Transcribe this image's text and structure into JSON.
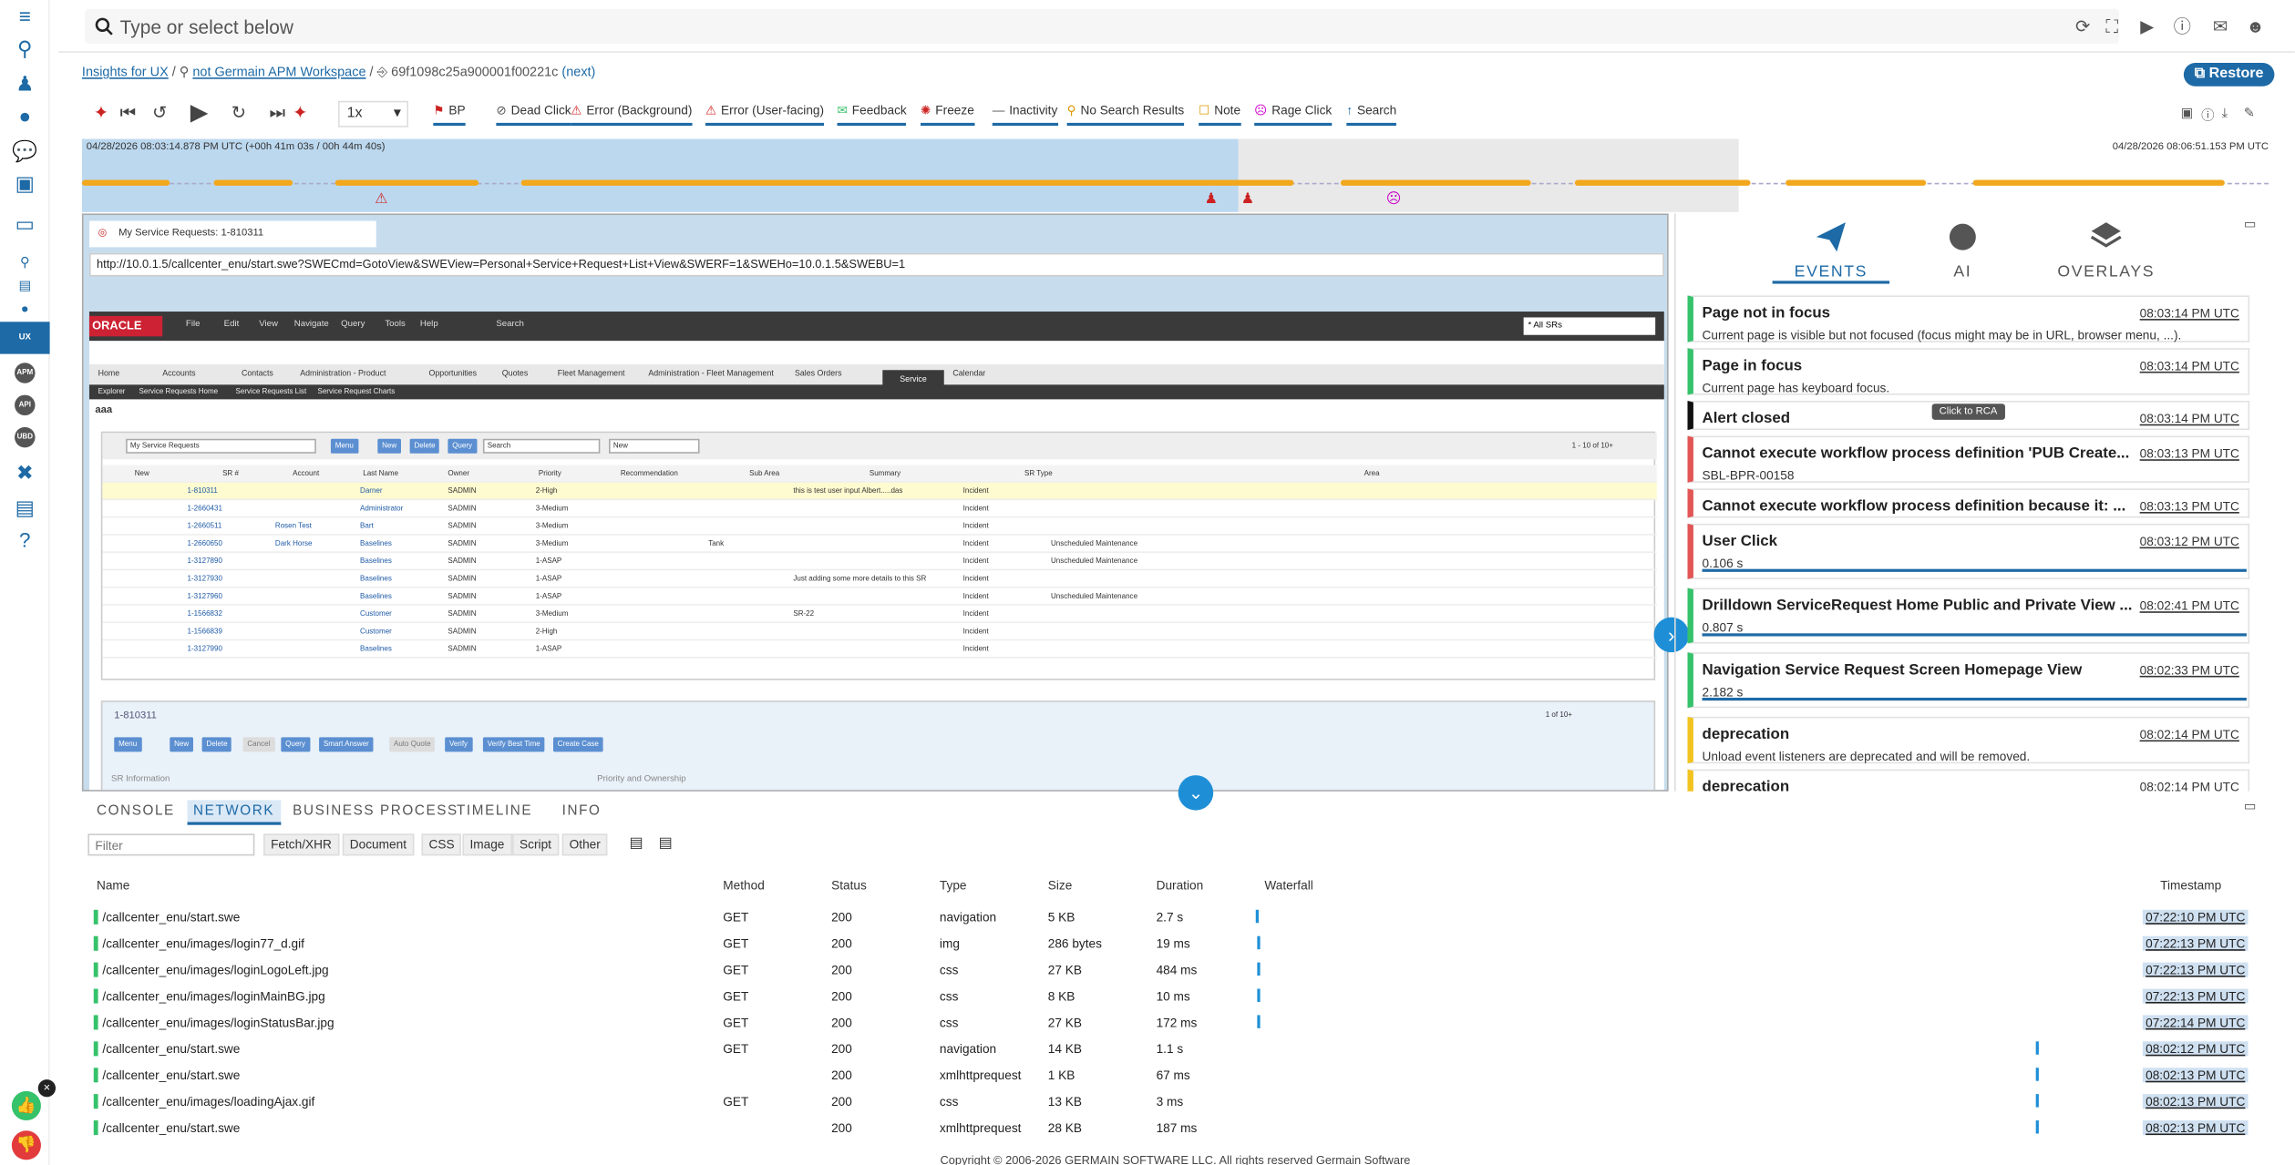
{
  "search": {
    "placeholder": "Type or select below"
  },
  "breadcrumb": {
    "home": "Insights for UX",
    "workspace": "not Germain APM Workspace",
    "session": "69f1098c25a900001f00221c",
    "next": "(next)"
  },
  "restore_label": "Restore",
  "controls": {
    "speed": "1x"
  },
  "event_filters": [
    "BP",
    "Dead Click",
    "Error (Background)",
    "Error (User-facing)",
    "Feedback",
    "Freeze",
    "Inactivity",
    "No Search Results",
    "Note",
    "Rage Click",
    "Search"
  ],
  "timeline": {
    "start": "04/28/2026 08:03:14.878 PM UTC (+00h 41m 03s / 00h 44m 40s)",
    "end": "04/28/2026 08:06:51.153 PM UTC"
  },
  "replay": {
    "tab_title": "My Service Requests: 1-810311",
    "url": "http://10.0.1.5/callcenter_enu/start.swe?SWECmd=GotoView&SWEView=Personal+Service+Request+List+View&SWERF=1&SWEHo=10.0.1.5&SWEBU=1",
    "menu": [
      "File",
      "Edit",
      "View",
      "Navigate",
      "Query",
      "Tools",
      "Help",
      "Search"
    ],
    "all_srs": "* All SRs",
    "tabs": [
      "Home",
      "Accounts",
      "Contacts",
      "Administration - Product",
      "Opportunities",
      "Quotes",
      "Fleet Management",
      "Administration - Fleet Management",
      "Sales Orders",
      "Service",
      "Calendar"
    ],
    "subtabs": [
      "Explorer",
      "Service Requests Home",
      "Service Requests List",
      "Service Request Charts"
    ],
    "aaa": "aaa",
    "list_view": "My Service Requests",
    "list_buttons": [
      "Menu",
      "New",
      "Delete",
      "Query"
    ],
    "list_search": "Search",
    "list_new": "New",
    "list_count": "1 - 10 of 10+",
    "columns": [
      "New",
      "SR #",
      "Account",
      "Last Name",
      "Owner",
      "Priority",
      "Recommendation",
      "Sub Area",
      "Summary",
      "SR Type",
      "Area"
    ],
    "rows": [
      [
        "1-810311",
        "",
        "Darner",
        "SADMIN",
        "2-High",
        "",
        "this is test user input Albert.....das",
        "Incident",
        ""
      ],
      [
        "1-2660431",
        "",
        "Administrator",
        "SADMIN",
        "3-Medium",
        "",
        "",
        "Incident",
        ""
      ],
      [
        "1-2660511",
        "Rosen Test",
        "Bart",
        "SADMIN",
        "3-Medium",
        "",
        "",
        "Incident",
        ""
      ],
      [
        "1-2660650",
        "Dark Horse",
        "Baselines",
        "SADMIN",
        "3-Medium",
        "Tank",
        "",
        "Incident",
        "Unscheduled Maintenance"
      ],
      [
        "1-3127890",
        "",
        "Baselines",
        "SADMIN",
        "1-ASAP",
        "",
        "",
        "Incident",
        "Unscheduled Maintenance"
      ],
      [
        "1-3127930",
        "",
        "Baselines",
        "SADMIN",
        "1-ASAP",
        "",
        "Just adding some more details to this SR",
        "Incident",
        ""
      ],
      [
        "1-3127960",
        "",
        "Baselines",
        "SADMIN",
        "1-ASAP",
        "",
        "",
        "Incident",
        "Unscheduled Maintenance"
      ],
      [
        "1-1566832",
        "",
        "Customer",
        "SADMIN",
        "3-Medium",
        "",
        "SR-22",
        "Incident",
        ""
      ],
      [
        "1-1566839",
        "",
        "Customer",
        "SADMIN",
        "2-High",
        "",
        "",
        "Incident",
        ""
      ],
      [
        "1-3127990",
        "",
        "Baselines",
        "SADMIN",
        "1-ASAP",
        "",
        "",
        "Incident",
        ""
      ]
    ],
    "form_id": "1-810311",
    "form_count": "1 of 10+",
    "form_buttons": [
      "Menu",
      "New",
      "Delete",
      "Cancel",
      "Query",
      "Smart Answer",
      "Auto Quote",
      "Verify",
      "Verify Best Time",
      "Create Case"
    ],
    "form_sections": [
      "SR Information",
      "Priority and Ownership"
    ]
  },
  "right_tabs": [
    "EVENTS",
    "AI",
    "OVERLAYS"
  ],
  "events": [
    {
      "title": "Page not in focus",
      "time": "08:03:14 PM UTC",
      "desc": "Current page is visible but not focused (focus might may be in URL, browser menu, ...).",
      "color": "#35c26b"
    },
    {
      "title": "Page in focus",
      "time": "08:03:14 PM UTC",
      "desc": "Current page has keyboard focus.",
      "color": "#35c26b"
    },
    {
      "title": "Alert closed",
      "time": "08:03:14 PM UTC",
      "desc": "",
      "color": "#111111"
    },
    {
      "title": "Cannot execute workflow process definition 'PUB Create...",
      "time": "08:03:13 PM UTC",
      "desc": "SBL-BPR-00158",
      "color": "#e25656"
    },
    {
      "title": "Cannot execute workflow process definition because it: ...",
      "time": "08:03:13 PM UTC",
      "desc": "",
      "color": "#e25656"
    },
    {
      "title": "User Click",
      "time": "08:03:12 PM UTC",
      "desc": "0.106 s",
      "color": "#e25656"
    },
    {
      "title": "Drilldown ServiceRequest Home Public and Private View ...",
      "time": "08:02:41 PM UTC",
      "desc": "0.807 s",
      "color": "#35c26b"
    },
    {
      "title": "Navigation Service Request Screen Homepage View",
      "time": "08:02:33 PM UTC",
      "desc": "2.182 s",
      "color": "#35c26b"
    },
    {
      "title": "deprecation",
      "time": "08:02:14 PM UTC",
      "desc": "Unload event listeners are deprecated and will be removed.",
      "color": "#f2c320"
    },
    {
      "title": "deprecation",
      "time": "08:02:14 PM UTC",
      "desc": "",
      "color": "#f2c320"
    }
  ],
  "tooltip": "Click to RCA",
  "bottom_tabs": [
    "CONSOLE",
    "NETWORK",
    "BUSINESS PROCESS",
    "TIMELINE",
    "INFO"
  ],
  "network": {
    "filter_placeholder": "Filter",
    "filter_buttons": [
      "Fetch/XHR",
      "Document",
      "CSS",
      "Image",
      "Script",
      "Other"
    ],
    "columns": [
      "Name",
      "Method",
      "Status",
      "Type",
      "Size",
      "Duration",
      "Waterfall",
      "Timestamp"
    ],
    "rows": [
      {
        "name": "/callcenter_enu/start.swe",
        "method": "GET",
        "status": "200",
        "type": "navigation",
        "size": "5 KB",
        "duration": "2.7 s",
        "timestamp": "07:22:10 PM UTC",
        "wf": 0.0
      },
      {
        "name": "/callcenter_enu/images/login77_d.gif",
        "method": "GET",
        "status": "200",
        "type": "img",
        "size": "286 bytes",
        "duration": "19 ms",
        "timestamp": "07:22:13 PM UTC",
        "wf": 0.001
      },
      {
        "name": "/callcenter_enu/images/loginLogoLeft.jpg",
        "method": "GET",
        "status": "200",
        "type": "css",
        "size": "27 KB",
        "duration": "484 ms",
        "timestamp": "07:22:13 PM UTC",
        "wf": 0.001
      },
      {
        "name": "/callcenter_enu/images/loginMainBG.jpg",
        "method": "GET",
        "status": "200",
        "type": "css",
        "size": "8 KB",
        "duration": "10 ms",
        "timestamp": "07:22:13 PM UTC",
        "wf": 0.001
      },
      {
        "name": "/callcenter_enu/images/loginStatusBar.jpg",
        "method": "GET",
        "status": "200",
        "type": "css",
        "size": "27 KB",
        "duration": "172 ms",
        "timestamp": "07:22:14 PM UTC",
        "wf": 0.001
      },
      {
        "name": "/callcenter_enu/start.swe",
        "method": "GET",
        "status": "200",
        "type": "navigation",
        "size": "14 KB",
        "duration": "1.1 s",
        "timestamp": "08:02:12 PM UTC",
        "wf": 0.86
      },
      {
        "name": "/callcenter_enu/start.swe",
        "method": "",
        "status": "200",
        "type": "xmlhttprequest",
        "size": "1 KB",
        "duration": "67 ms",
        "timestamp": "08:02:13 PM UTC",
        "wf": 0.86
      },
      {
        "name": "/callcenter_enu/images/loadingAjax.gif",
        "method": "GET",
        "status": "200",
        "type": "css",
        "size": "13 KB",
        "duration": "3 ms",
        "timestamp": "08:02:13 PM UTC",
        "wf": 0.86
      },
      {
        "name": "/callcenter_enu/start.swe",
        "method": "",
        "status": "200",
        "type": "xmlhttprequest",
        "size": "28 KB",
        "duration": "187 ms",
        "timestamp": "08:02:13 PM UTC",
        "wf": 0.86
      }
    ]
  },
  "footer": "Copyright © 2006-2026 GERMAIN SOFTWARE LLC. All rights reserved Germain Software",
  "colors": {
    "accent": "#1e6aa6",
    "timeline_bar": "#f2a81d",
    "success": "#35c26b",
    "error": "#e25656"
  }
}
